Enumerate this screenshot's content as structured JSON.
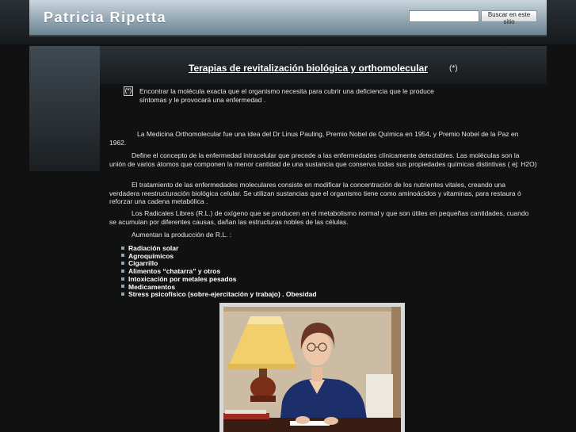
{
  "header": {
    "site_title": "Patricia Ripetta",
    "search": {
      "value": "",
      "button_label": "Buscar en este sitio"
    }
  },
  "main": {
    "title": "Terapias de revitalización biológica y orthomolecular",
    "title_ref": "(*)",
    "footnote": {
      "marker": "(*)",
      "text": "Encontrar la molécula exacta que el organismo necesita para cubrir una deficiencia que le produce síntomas y le provocará una enfermedad ."
    },
    "paragraphs": [
      "La Medicina Orthomolecular fue una idea del Dr Linus Pauling, Premio Nobel de Química en 1954, y Premio Nobel de la Paz en 1962.",
      "Define el concepto de la enfermedad intracelular que precede a las enfermedades clínicamente detectables. Las moléculas son  la unión de varios átomos que componen la menor cantidad de una sustancia que conserva todas sus propiedades químicas distintivas ( ej: H2O)",
      "El tratamiento de las enfermedades moleculares consiste en modificar la concentración de los nutrientes vitales, creando una verdadera reestructuración biológica celular. Se utilizan sustancias que el organismo tiene como aminoácidos y vitaminas, para restaura ó reforzar una cadena metabólica .",
      "Los Radicales Libres (R.L.) de oxígeno que se producen en el metabolismo normal y que son útiles en pequeñas cantidades, cuando se acumulan por diferentes causas, dañan las estructuras nobles de las células.",
      "Aumentan la producción de R.L. :"
    ],
    "bullets": [
      "Radiación solar",
      "Agroquímicos",
      "Cigarrillo",
      "Alimentos “chatarra” y otros",
      "Intoxicación por metales pesados",
      "Medicamentos",
      "Stress psicofísico (sobre-ejercitación y trabajo)    . Obesidad"
    ]
  },
  "colors": {
    "background": "#111111",
    "header_light": "#c9d6dd",
    "header_dark": "#6c8593",
    "bullet": "#8aa7b8"
  }
}
